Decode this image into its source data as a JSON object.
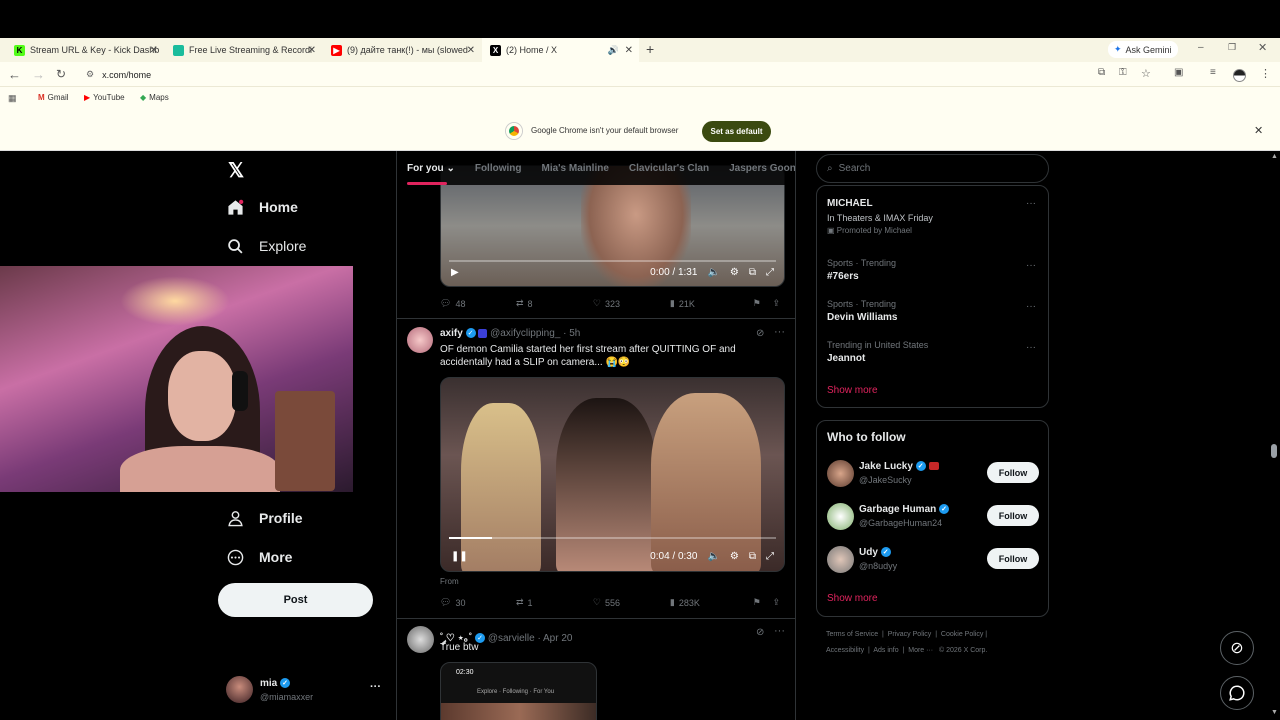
{
  "browser": {
    "tabs": [
      {
        "title": "Stream URL & Key - Kick Dashb",
        "icon_color": "#53fc18",
        "icon_letter": "K"
      },
      {
        "title": "Free Live Streaming & Recordi",
        "icon_color": "#1abc9c",
        "icon_letter": ""
      },
      {
        "title": "(9) дайте танк(!) - мы (slowed",
        "icon_color": "#ff0000",
        "icon_letter": "▶"
      },
      {
        "title": "(2) Home / X",
        "icon_color": "#000000",
        "icon_letter": "X"
      }
    ],
    "ask_gemini": "Ask Gemini",
    "url": "x.com/home",
    "bookmarks": [
      "Gmail",
      "YouTube",
      "Maps"
    ],
    "infobar_text": "Google Chrome isn't your default browser",
    "infobar_button": "Set as default"
  },
  "nav": {
    "home": "Home",
    "explore": "Explore",
    "profile": "Profile",
    "more": "More",
    "post": "Post",
    "account_name": "mia",
    "account_handle": "@miamaxxer"
  },
  "feed": {
    "tabs": [
      "For you",
      "Following",
      "Mia's Mainline",
      "Clavicular's Clan",
      "Jaspers Goons"
    ],
    "post1": {
      "video_time": "0:00 / 1:31",
      "replies": "48",
      "reposts": "8",
      "likes": "323",
      "views": "21K"
    },
    "post2": {
      "name": "axify",
      "handle": "@axifyclipping_",
      "time": "· 5h",
      "text": "OF demon Camilia started her first stream after QUITTING OF and accidentally had a SLIP on camera... 😭😳",
      "video_time": "0:04 / 0:30",
      "from_label": "From",
      "replies": "30",
      "reposts": "1",
      "likes": "556",
      "views": "283K"
    },
    "post3": {
      "name": "˚ ༘♡ ⋆｡˚",
      "handle": "@sarvielle",
      "time": "· Apr 20",
      "text": "True btw",
      "phone_time": "02:30",
      "phone_tabs": "Explore · Following · For You"
    }
  },
  "sidebar": {
    "search_placeholder": "Search",
    "trends": [
      {
        "category": "",
        "title": "MICHAEL",
        "sub": "In Theaters & IMAX Friday",
        "promo": "Promoted by Michael"
      },
      {
        "category": "Sports · Trending",
        "title": "#76ers"
      },
      {
        "category": "Sports · Trending",
        "title": "Devin Williams"
      },
      {
        "category": "Trending in United States",
        "title": "Jeannot"
      }
    ],
    "show_more": "Show more",
    "who_to_follow": "Who to follow",
    "follow": [
      {
        "name": "Jake Lucky",
        "handle": "@JakeSucky"
      },
      {
        "name": "Garbage Human",
        "handle": "@GarbageHuman24"
      },
      {
        "name": "Udy",
        "handle": "@n8udyy"
      }
    ],
    "follow_label": "Follow",
    "footer_line1": [
      "Terms of Service",
      "Privacy Policy",
      "Cookie Policy"
    ],
    "footer_line2": [
      "Accessibility",
      "Ads info",
      "More ···",
      "© 2026 X Corp."
    ]
  },
  "colors": {
    "accent": "#e0245e",
    "verified": "#1d9bf0",
    "brand_bar": "#f7f5e4"
  }
}
